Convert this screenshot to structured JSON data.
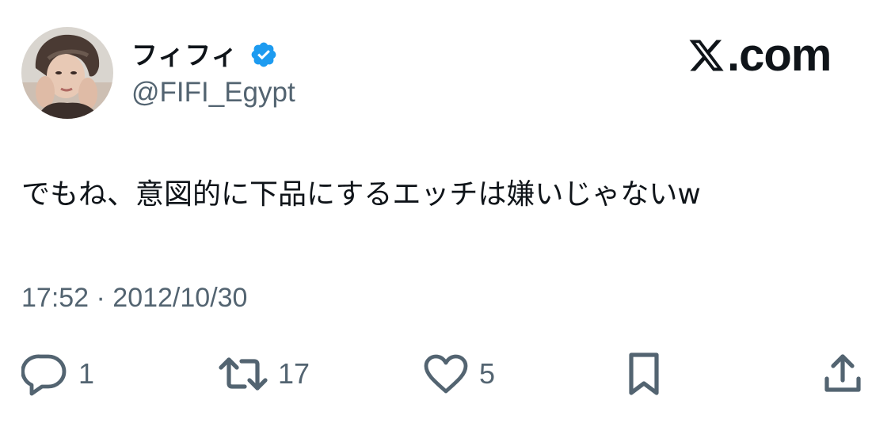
{
  "author": {
    "display_name": "フィフィ",
    "handle": "@FIFI_Egypt",
    "verified": true,
    "avatar": "profile-photo"
  },
  "brand": {
    "text": "com",
    "prefix": ".",
    "logo_icon": "x-logo-icon"
  },
  "tweet": {
    "text": "でもね、意図的に下品にするエッチは嫌いじゃないw",
    "timestamp": "17:52 · 2012/10/30"
  },
  "actions": {
    "reply": {
      "icon": "reply-icon",
      "count": "1"
    },
    "retweet": {
      "icon": "retweet-icon",
      "count": "17"
    },
    "like": {
      "icon": "heart-icon",
      "count": "5"
    },
    "bookmark": {
      "icon": "bookmark-icon"
    },
    "share": {
      "icon": "share-icon"
    }
  },
  "colors": {
    "text_primary": "#0f1419",
    "text_secondary": "#536471",
    "verified_badge": "#1d9bf0",
    "background": "#ffffff"
  }
}
